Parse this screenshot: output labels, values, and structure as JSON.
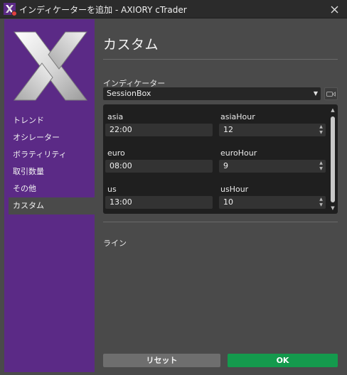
{
  "window": {
    "title": "インディケーターを追加 - AXIORY cTrader"
  },
  "sidebar": {
    "items": [
      {
        "label": "トレンド"
      },
      {
        "label": "オシレーター"
      },
      {
        "label": "ボラティリティ"
      },
      {
        "label": "取引数量"
      },
      {
        "label": "その他"
      },
      {
        "label": "カスタム",
        "active": true
      }
    ]
  },
  "main": {
    "title": "カスタム",
    "indicator_label": "インディケーター",
    "indicator_selected": "SessionBox",
    "params": {
      "asia_label": "asia",
      "asia_value": "22:00",
      "asia_hour_label": "asiaHour",
      "asia_hour_value": "12",
      "euro_label": "euro",
      "euro_value": "08:00",
      "euro_hour_label": "euroHour",
      "euro_hour_value": "9",
      "us_label": "us",
      "us_value": "13:00",
      "us_hour_label": "usHour",
      "us_hour_value": "10"
    },
    "lines_label": "ライン"
  },
  "buttons": {
    "reset_label": "リセット",
    "ok_label": "OK"
  },
  "icons": {
    "app": "axiory-x-icon",
    "close": "close-icon",
    "dropdown": "chevron-down-icon",
    "camera": "camera-icon",
    "spin_up": "spin-up-icon",
    "spin_down": "spin-down-icon"
  },
  "colors": {
    "sidebar": "#5b2a86",
    "background": "#4a4a4a",
    "titlebar": "#2b2b2b",
    "params_panel": "#1f1f1f",
    "ok_button": "#149a4d",
    "reset_button": "#6e6e6e"
  }
}
